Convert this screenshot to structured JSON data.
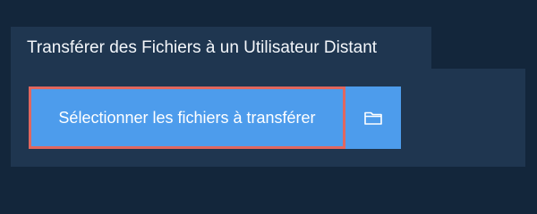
{
  "header": {
    "title": "Transférer des Fichiers à un Utilisateur Distant"
  },
  "actions": {
    "select_files_label": "Sélectionner les fichiers à transférer",
    "folder_icon": "folder-icon"
  },
  "colors": {
    "background": "#13263b",
    "panel": "#1f3650",
    "button": "#4d9cec",
    "highlight_border": "#e0675f"
  }
}
